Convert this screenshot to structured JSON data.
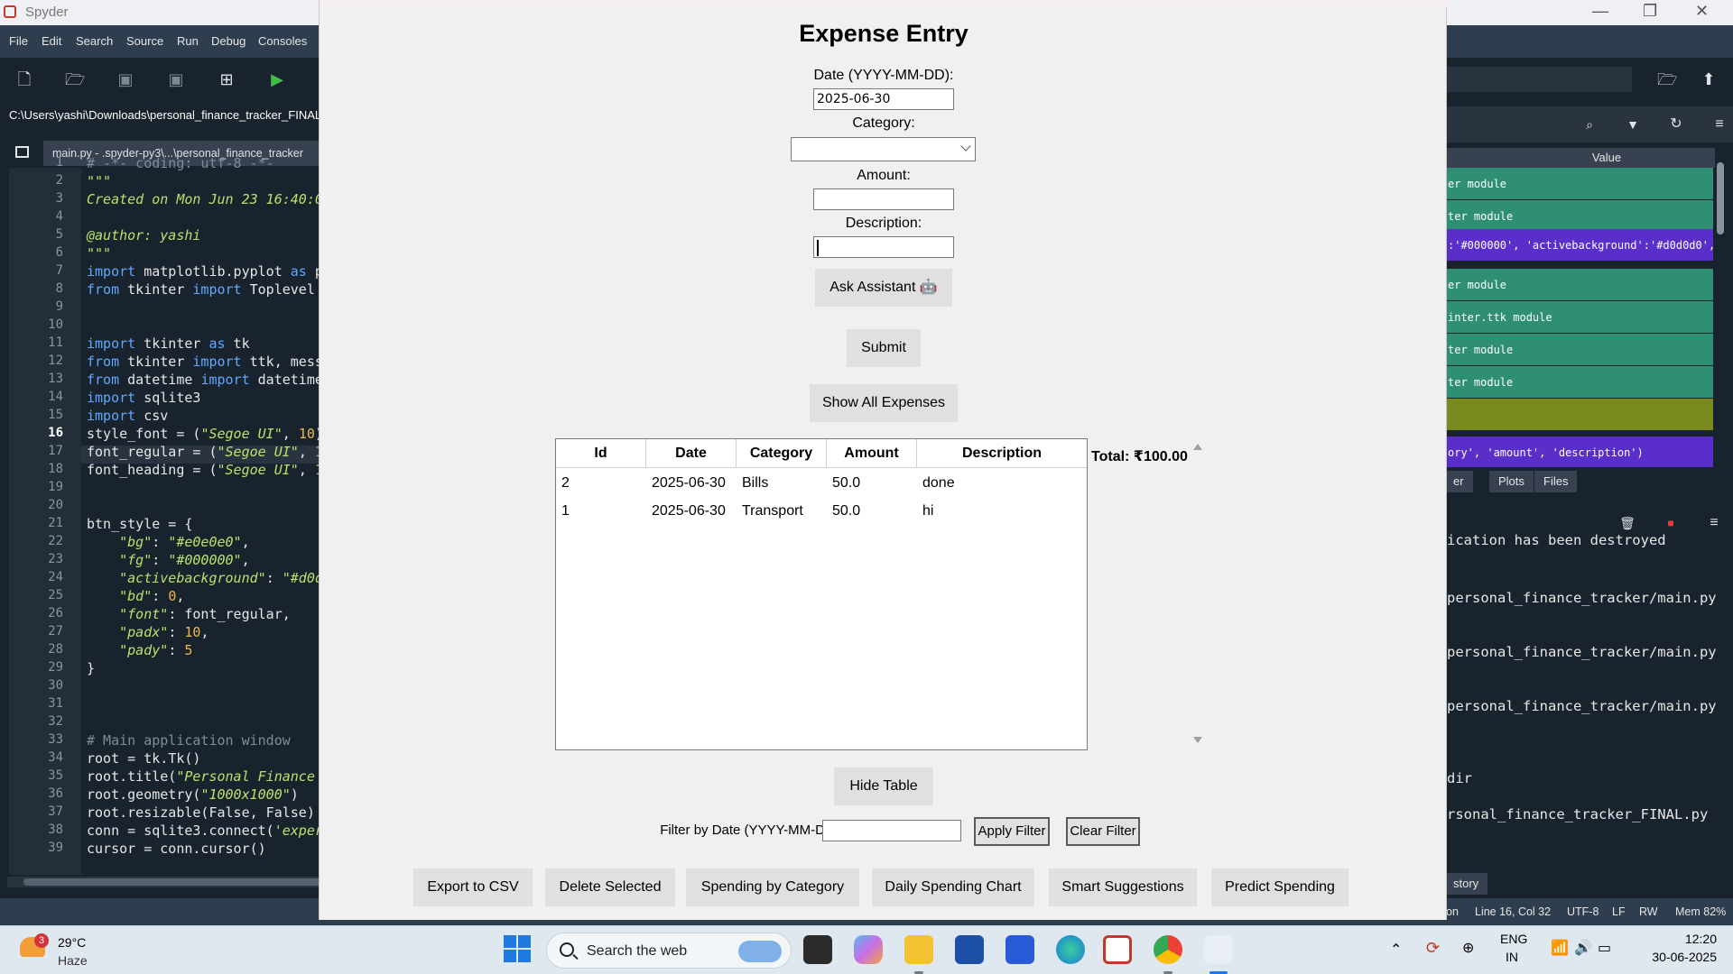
{
  "spyder": {
    "title": "Spyder",
    "menu": [
      "File",
      "Edit",
      "Search",
      "Source",
      "Run",
      "Debug",
      "Consoles"
    ],
    "path": "C:\\Users\\yashi\\Downloads\\personal_finance_tracker_FINAL",
    "tab_label": "main.py - .spyder-py3\\...\\personal_finance_tracker",
    "code_lines": [
      {
        "n": "1",
        "t": "# -*- coding: utf-8 -*-"
      },
      {
        "n": "2",
        "t": "\"\"\""
      },
      {
        "n": "3",
        "t": "Created on Mon Jun 23 16:40:0"
      },
      {
        "n": "4",
        "t": ""
      },
      {
        "n": "5",
        "t": "@author: yashi"
      },
      {
        "n": "6",
        "t": "\"\"\""
      },
      {
        "n": "7",
        "t": "import matplotlib.pyplot as p"
      },
      {
        "n": "8",
        "t": "from tkinter import Toplevel"
      },
      {
        "n": "9",
        "t": ""
      },
      {
        "n": "10",
        "t": ""
      },
      {
        "n": "11",
        "t": "import tkinter as tk"
      },
      {
        "n": "12",
        "t": "from tkinter import ttk, mess"
      },
      {
        "n": "13",
        "t": "from datetime import datetime"
      },
      {
        "n": "14",
        "t": "import sqlite3"
      },
      {
        "n": "15",
        "t": "import csv"
      },
      {
        "n": "16",
        "t": "style_font = (\"Segoe UI\", 10)"
      },
      {
        "n": "17",
        "t": "font_regular = (\"Segoe UI\", 1"
      },
      {
        "n": "18",
        "t": "font_heading = (\"Segoe UI\", 1"
      },
      {
        "n": "19",
        "t": ""
      },
      {
        "n": "20",
        "t": ""
      },
      {
        "n": "21",
        "t": "btn_style = {"
      },
      {
        "n": "22",
        "t": "    \"bg\": \"#e0e0e0\","
      },
      {
        "n": "23",
        "t": "    \"fg\": \"#000000\","
      },
      {
        "n": "24",
        "t": "    \"activebackground\": \"#d0d"
      },
      {
        "n": "25",
        "t": "    \"bd\": 0,"
      },
      {
        "n": "26",
        "t": "    \"font\": font_regular,"
      },
      {
        "n": "27",
        "t": "    \"padx\": 10,"
      },
      {
        "n": "28",
        "t": "    \"pady\": 5"
      },
      {
        "n": "29",
        "t": "}"
      },
      {
        "n": "30",
        "t": ""
      },
      {
        "n": "31",
        "t": ""
      },
      {
        "n": "32",
        "t": ""
      },
      {
        "n": "33",
        "t": "# Main application window"
      },
      {
        "n": "34",
        "t": "root = tk.Tk()"
      },
      {
        "n": "35",
        "t": "root.title(\"Personal Finance "
      },
      {
        "n": "36",
        "t": "root.geometry(\"1000x1000\")"
      },
      {
        "n": "37",
        "t": "root.resizable(False, False)"
      },
      {
        "n": "38",
        "t": "conn = sqlite3.connect('exper"
      },
      {
        "n": "39",
        "t": "cursor = conn.cursor()"
      }
    ],
    "var_header": "Value",
    "var_rows": [
      {
        "text": "er module",
        "color": "teal"
      },
      {
        "text": "ter module",
        "color": "teal"
      },
      {
        "text": ":'#000000', 'activebackground':'#d0d0d0',",
        "color": "purple"
      },
      {
        "text": "er module",
        "color": "teal"
      },
      {
        "text": "inter.ttk module",
        "color": "teal"
      },
      {
        "text": "ter module",
        "color": "teal"
      },
      {
        "text": "ter module",
        "color": "teal"
      },
      {
        "text": "",
        "color": "olive"
      },
      {
        "text": "ory', 'amount', 'description')",
        "color": "purple"
      }
    ],
    "pane_tabs": [
      "er",
      "Plots",
      "Files"
    ],
    "console_lines": [
      "ication has been destroyed",
      "personal_finance_tracker/main.py",
      "personal_finance_tracker/main.py",
      "personal_finance_tracker/main.py",
      "dir",
      "rsonal_finance_tracker_FINAL.py"
    ],
    "console_tab": "story",
    "status": {
      "a": "on",
      "line_col": "Line 16, Col 32",
      "enc": "UTF-8",
      "eol": "LF",
      "rw": "RW",
      "mem": "Mem 82%"
    }
  },
  "app": {
    "heading": "Expense Entry",
    "date_label": "Date (YYYY-MM-DD):",
    "date_value": "2025-06-30",
    "category_label": "Category:",
    "category_value": "",
    "amount_label": "Amount:",
    "amount_value": "",
    "description_label": "Description:",
    "description_value": "",
    "ask_assistant": "Ask Assistant 🤖",
    "submit": "Submit",
    "show_all": "Show All Expenses",
    "table": {
      "columns": [
        "Id",
        "Date",
        "Category",
        "Amount",
        "Description"
      ],
      "rows": [
        {
          "id": "2",
          "date": "2025-06-30",
          "category": "Bills",
          "amount": "50.0",
          "description": "done"
        },
        {
          "id": "1",
          "date": "2025-06-30",
          "category": "Transport",
          "amount": "50.0",
          "description": "hi"
        }
      ]
    },
    "total": "Total: ₹100.00",
    "hide_table": "Hide Table",
    "filter_label": "Filter by Date (YYYY-MM-DD):",
    "filter_value": "",
    "apply_filter": "Apply Filter",
    "clear_filter": "Clear Filter",
    "bottom_buttons": [
      "Export to CSV",
      "Delete Selected",
      "Spending by Category",
      "Daily Spending Chart",
      "Smart Suggestions",
      "Predict Spending"
    ]
  },
  "taskbar": {
    "weather_badge": "3",
    "weather_temp": "29°C",
    "weather_cond": "Haze",
    "search_text": "Search the web",
    "lang_1": "ENG",
    "lang_2": "IN",
    "time": "12:20",
    "date": "30-06-2025"
  }
}
